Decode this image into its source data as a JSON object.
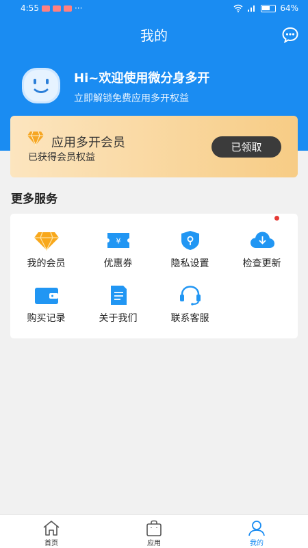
{
  "status_bar": {
    "time": "4:55",
    "battery": "64%"
  },
  "header": {
    "title": "我的"
  },
  "profile": {
    "greeting": "Hi~欢迎使用微分身多开",
    "subtitle": "立即解锁免费应用多开权益"
  },
  "membership": {
    "title": "应用多开会员",
    "subtitle": "已获得会员权益",
    "button_label": "已领取"
  },
  "services": {
    "section_title": "更多服务",
    "items": [
      {
        "label": "我的会员",
        "icon": "diamond-icon"
      },
      {
        "label": "优惠券",
        "icon": "coupon-icon"
      },
      {
        "label": "隐私设置",
        "icon": "shield-icon"
      },
      {
        "label": "检查更新",
        "icon": "cloud-download-icon"
      },
      {
        "label": "购买记录",
        "icon": "wallet-icon"
      },
      {
        "label": "关于我们",
        "icon": "document-icon"
      },
      {
        "label": "联系客服",
        "icon": "headset-icon"
      }
    ]
  },
  "bottom_nav": {
    "items": [
      {
        "label": "首页",
        "icon": "home-icon"
      },
      {
        "label": "应用",
        "icon": "bag-icon"
      },
      {
        "label": "我的",
        "icon": "user-icon",
        "active": true
      }
    ]
  },
  "colors": {
    "primary": "#1a8cf2",
    "card_gold": "#f7cc85",
    "button_dark": "#3b3b3b"
  }
}
